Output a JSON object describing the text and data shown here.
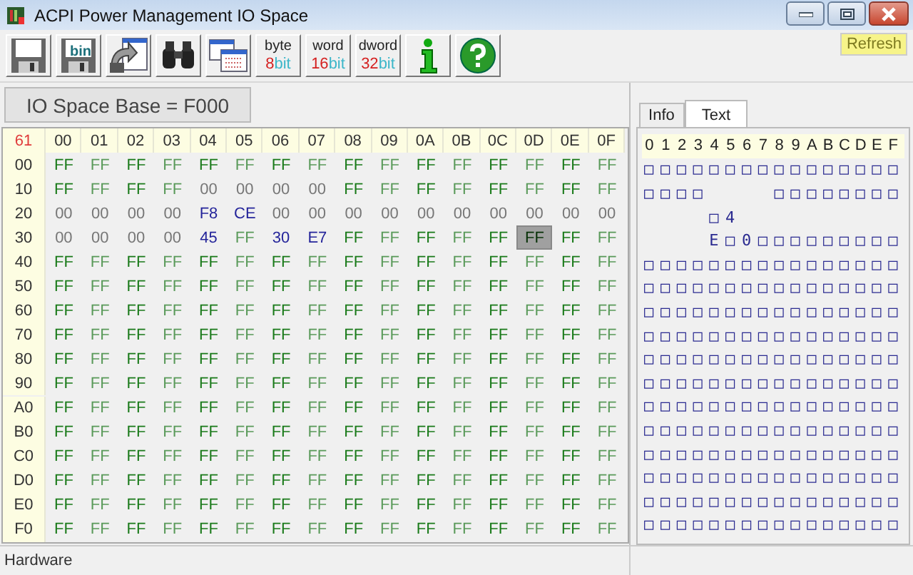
{
  "window": {
    "title": "ACPI Power Management IO Space"
  },
  "toolbar": [
    {
      "kind": "save"
    },
    {
      "kind": "savebin",
      "label": "bin"
    },
    {
      "kind": "export"
    },
    {
      "kind": "find"
    },
    {
      "kind": "windows"
    },
    {
      "kind": "width",
      "top": "byte",
      "num": "8",
      "unit": "bit",
      "selected": false
    },
    {
      "kind": "width",
      "top": "word",
      "num": "16",
      "unit": "bit",
      "selected": false
    },
    {
      "kind": "width",
      "top": "dword",
      "num": "32",
      "unit": "bit",
      "selected": false
    },
    {
      "kind": "info"
    },
    {
      "kind": "help"
    }
  ],
  "refresh_button": "Refresh",
  "base_label": "IO Space Base = F000",
  "grid": {
    "corner": "61",
    "columns": [
      "00",
      "01",
      "02",
      "03",
      "04",
      "05",
      "06",
      "07",
      "08",
      "09",
      "0A",
      "0B",
      "0C",
      "0D",
      "0E",
      "0F"
    ],
    "rows": [
      {
        "address": "00",
        "cells": [
          {
            "text": "FF",
            "kind": "set",
            "selected": false
          },
          {
            "text": "FF",
            "kind": "set",
            "selected": false
          },
          {
            "text": "FF",
            "kind": "set",
            "selected": false
          },
          {
            "text": "FF",
            "kind": "set",
            "selected": false
          },
          {
            "text": "FF",
            "kind": "set",
            "selected": false
          },
          {
            "text": "FF",
            "kind": "set",
            "selected": false
          },
          {
            "text": "FF",
            "kind": "set",
            "selected": false
          },
          {
            "text": "FF",
            "kind": "set",
            "selected": false
          },
          {
            "text": "FF",
            "kind": "set",
            "selected": false
          },
          {
            "text": "FF",
            "kind": "set",
            "selected": false
          },
          {
            "text": "FF",
            "kind": "set",
            "selected": false
          },
          {
            "text": "FF",
            "kind": "set",
            "selected": false
          },
          {
            "text": "FF",
            "kind": "set",
            "selected": false
          },
          {
            "text": "FF",
            "kind": "set",
            "selected": false
          },
          {
            "text": "FF",
            "kind": "set",
            "selected": false
          },
          {
            "text": "FF",
            "kind": "set",
            "selected": false
          }
        ]
      },
      {
        "address": "10",
        "cells": [
          {
            "text": "FF",
            "kind": "set",
            "selected": false
          },
          {
            "text": "FF",
            "kind": "set",
            "selected": false
          },
          {
            "text": "FF",
            "kind": "set",
            "selected": false
          },
          {
            "text": "FF",
            "kind": "set",
            "selected": false
          },
          {
            "text": "00",
            "kind": "zero",
            "selected": false
          },
          {
            "text": "00",
            "kind": "zero",
            "selected": false
          },
          {
            "text": "00",
            "kind": "zero",
            "selected": false
          },
          {
            "text": "00",
            "kind": "zero",
            "selected": false
          },
          {
            "text": "FF",
            "kind": "set",
            "selected": false
          },
          {
            "text": "FF",
            "kind": "set",
            "selected": false
          },
          {
            "text": "FF",
            "kind": "set",
            "selected": false
          },
          {
            "text": "FF",
            "kind": "set",
            "selected": false
          },
          {
            "text": "FF",
            "kind": "set",
            "selected": false
          },
          {
            "text": "FF",
            "kind": "set",
            "selected": false
          },
          {
            "text": "FF",
            "kind": "set",
            "selected": false
          },
          {
            "text": "FF",
            "kind": "set",
            "selected": false
          }
        ]
      },
      {
        "address": "20",
        "cells": [
          {
            "text": "00",
            "kind": "zero",
            "selected": false
          },
          {
            "text": "00",
            "kind": "zero",
            "selected": false
          },
          {
            "text": "00",
            "kind": "zero",
            "selected": false
          },
          {
            "text": "00",
            "kind": "zero",
            "selected": false
          },
          {
            "text": "F8",
            "kind": "data",
            "selected": false
          },
          {
            "text": "CE",
            "kind": "data",
            "selected": false
          },
          {
            "text": "00",
            "kind": "zero",
            "selected": false
          },
          {
            "text": "00",
            "kind": "zero",
            "selected": false
          },
          {
            "text": "00",
            "kind": "zero",
            "selected": false
          },
          {
            "text": "00",
            "kind": "zero",
            "selected": false
          },
          {
            "text": "00",
            "kind": "zero",
            "selected": false
          },
          {
            "text": "00",
            "kind": "zero",
            "selected": false
          },
          {
            "text": "00",
            "kind": "zero",
            "selected": false
          },
          {
            "text": "00",
            "kind": "zero",
            "selected": false
          },
          {
            "text": "00",
            "kind": "zero",
            "selected": false
          },
          {
            "text": "00",
            "kind": "zero",
            "selected": false
          }
        ]
      },
      {
        "address": "30",
        "cells": [
          {
            "text": "00",
            "kind": "zero",
            "selected": false
          },
          {
            "text": "00",
            "kind": "zero",
            "selected": false
          },
          {
            "text": "00",
            "kind": "zero",
            "selected": false
          },
          {
            "text": "00",
            "kind": "zero",
            "selected": false
          },
          {
            "text": "45",
            "kind": "data",
            "selected": false
          },
          {
            "text": "FF",
            "kind": "set",
            "selected": false
          },
          {
            "text": "30",
            "kind": "data",
            "selected": false
          },
          {
            "text": "E7",
            "kind": "data",
            "selected": false
          },
          {
            "text": "FF",
            "kind": "set",
            "selected": false
          },
          {
            "text": "FF",
            "kind": "set",
            "selected": false
          },
          {
            "text": "FF",
            "kind": "set",
            "selected": false
          },
          {
            "text": "FF",
            "kind": "set",
            "selected": false
          },
          {
            "text": "FF",
            "kind": "set",
            "selected": false
          },
          {
            "text": "FF",
            "kind": "set",
            "selected": true
          },
          {
            "text": "FF",
            "kind": "set",
            "selected": false
          },
          {
            "text": "FF",
            "kind": "set",
            "selected": false
          }
        ]
      },
      {
        "address": "40",
        "cells": [
          {
            "text": "FF",
            "kind": "set",
            "selected": false
          },
          {
            "text": "FF",
            "kind": "set",
            "selected": false
          },
          {
            "text": "FF",
            "kind": "set",
            "selected": false
          },
          {
            "text": "FF",
            "kind": "set",
            "selected": false
          },
          {
            "text": "FF",
            "kind": "set",
            "selected": false
          },
          {
            "text": "FF",
            "kind": "set",
            "selected": false
          },
          {
            "text": "FF",
            "kind": "set",
            "selected": false
          },
          {
            "text": "FF",
            "kind": "set",
            "selected": false
          },
          {
            "text": "FF",
            "kind": "set",
            "selected": false
          },
          {
            "text": "FF",
            "kind": "set",
            "selected": false
          },
          {
            "text": "FF",
            "kind": "set",
            "selected": false
          },
          {
            "text": "FF",
            "kind": "set",
            "selected": false
          },
          {
            "text": "FF",
            "kind": "set",
            "selected": false
          },
          {
            "text": "FF",
            "kind": "set",
            "selected": false
          },
          {
            "text": "FF",
            "kind": "set",
            "selected": false
          },
          {
            "text": "FF",
            "kind": "set",
            "selected": false
          }
        ]
      },
      {
        "address": "50",
        "cells": [
          {
            "text": "FF",
            "kind": "set",
            "selected": false
          },
          {
            "text": "FF",
            "kind": "set",
            "selected": false
          },
          {
            "text": "FF",
            "kind": "set",
            "selected": false
          },
          {
            "text": "FF",
            "kind": "set",
            "selected": false
          },
          {
            "text": "FF",
            "kind": "set",
            "selected": false
          },
          {
            "text": "FF",
            "kind": "set",
            "selected": false
          },
          {
            "text": "FF",
            "kind": "set",
            "selected": false
          },
          {
            "text": "FF",
            "kind": "set",
            "selected": false
          },
          {
            "text": "FF",
            "kind": "set",
            "selected": false
          },
          {
            "text": "FF",
            "kind": "set",
            "selected": false
          },
          {
            "text": "FF",
            "kind": "set",
            "selected": false
          },
          {
            "text": "FF",
            "kind": "set",
            "selected": false
          },
          {
            "text": "FF",
            "kind": "set",
            "selected": false
          },
          {
            "text": "FF",
            "kind": "set",
            "selected": false
          },
          {
            "text": "FF",
            "kind": "set",
            "selected": false
          },
          {
            "text": "FF",
            "kind": "set",
            "selected": false
          }
        ]
      },
      {
        "address": "60",
        "cells": [
          {
            "text": "FF",
            "kind": "set",
            "selected": false
          },
          {
            "text": "FF",
            "kind": "set",
            "selected": false
          },
          {
            "text": "FF",
            "kind": "set",
            "selected": false
          },
          {
            "text": "FF",
            "kind": "set",
            "selected": false
          },
          {
            "text": "FF",
            "kind": "set",
            "selected": false
          },
          {
            "text": "FF",
            "kind": "set",
            "selected": false
          },
          {
            "text": "FF",
            "kind": "set",
            "selected": false
          },
          {
            "text": "FF",
            "kind": "set",
            "selected": false
          },
          {
            "text": "FF",
            "kind": "set",
            "selected": false
          },
          {
            "text": "FF",
            "kind": "set",
            "selected": false
          },
          {
            "text": "FF",
            "kind": "set",
            "selected": false
          },
          {
            "text": "FF",
            "kind": "set",
            "selected": false
          },
          {
            "text": "FF",
            "kind": "set",
            "selected": false
          },
          {
            "text": "FF",
            "kind": "set",
            "selected": false
          },
          {
            "text": "FF",
            "kind": "set",
            "selected": false
          },
          {
            "text": "FF",
            "kind": "set",
            "selected": false
          }
        ]
      },
      {
        "address": "70",
        "cells": [
          {
            "text": "FF",
            "kind": "set",
            "selected": false
          },
          {
            "text": "FF",
            "kind": "set",
            "selected": false
          },
          {
            "text": "FF",
            "kind": "set",
            "selected": false
          },
          {
            "text": "FF",
            "kind": "set",
            "selected": false
          },
          {
            "text": "FF",
            "kind": "set",
            "selected": false
          },
          {
            "text": "FF",
            "kind": "set",
            "selected": false
          },
          {
            "text": "FF",
            "kind": "set",
            "selected": false
          },
          {
            "text": "FF",
            "kind": "set",
            "selected": false
          },
          {
            "text": "FF",
            "kind": "set",
            "selected": false
          },
          {
            "text": "FF",
            "kind": "set",
            "selected": false
          },
          {
            "text": "FF",
            "kind": "set",
            "selected": false
          },
          {
            "text": "FF",
            "kind": "set",
            "selected": false
          },
          {
            "text": "FF",
            "kind": "set",
            "selected": false
          },
          {
            "text": "FF",
            "kind": "set",
            "selected": false
          },
          {
            "text": "FF",
            "kind": "set",
            "selected": false
          },
          {
            "text": "FF",
            "kind": "set",
            "selected": false
          }
        ]
      },
      {
        "address": "80",
        "cells": [
          {
            "text": "FF",
            "kind": "set",
            "selected": false
          },
          {
            "text": "FF",
            "kind": "set",
            "selected": false
          },
          {
            "text": "FF",
            "kind": "set",
            "selected": false
          },
          {
            "text": "FF",
            "kind": "set",
            "selected": false
          },
          {
            "text": "FF",
            "kind": "set",
            "selected": false
          },
          {
            "text": "FF",
            "kind": "set",
            "selected": false
          },
          {
            "text": "FF",
            "kind": "set",
            "selected": false
          },
          {
            "text": "FF",
            "kind": "set",
            "selected": false
          },
          {
            "text": "FF",
            "kind": "set",
            "selected": false
          },
          {
            "text": "FF",
            "kind": "set",
            "selected": false
          },
          {
            "text": "FF",
            "kind": "set",
            "selected": false
          },
          {
            "text": "FF",
            "kind": "set",
            "selected": false
          },
          {
            "text": "FF",
            "kind": "set",
            "selected": false
          },
          {
            "text": "FF",
            "kind": "set",
            "selected": false
          },
          {
            "text": "FF",
            "kind": "set",
            "selected": false
          },
          {
            "text": "FF",
            "kind": "set",
            "selected": false
          }
        ]
      },
      {
        "address": "90",
        "cells": [
          {
            "text": "FF",
            "kind": "set",
            "selected": false
          },
          {
            "text": "FF",
            "kind": "set",
            "selected": false
          },
          {
            "text": "FF",
            "kind": "set",
            "selected": false
          },
          {
            "text": "FF",
            "kind": "set",
            "selected": false
          },
          {
            "text": "FF",
            "kind": "set",
            "selected": false
          },
          {
            "text": "FF",
            "kind": "set",
            "selected": false
          },
          {
            "text": "FF",
            "kind": "set",
            "selected": false
          },
          {
            "text": "FF",
            "kind": "set",
            "selected": false
          },
          {
            "text": "FF",
            "kind": "set",
            "selected": false
          },
          {
            "text": "FF",
            "kind": "set",
            "selected": false
          },
          {
            "text": "FF",
            "kind": "set",
            "selected": false
          },
          {
            "text": "FF",
            "kind": "set",
            "selected": false
          },
          {
            "text": "FF",
            "kind": "set",
            "selected": false
          },
          {
            "text": "FF",
            "kind": "set",
            "selected": false
          },
          {
            "text": "FF",
            "kind": "set",
            "selected": false
          },
          {
            "text": "FF",
            "kind": "set",
            "selected": false
          }
        ]
      },
      {
        "address": "A0",
        "cells": [
          {
            "text": "FF",
            "kind": "set",
            "selected": false
          },
          {
            "text": "FF",
            "kind": "set",
            "selected": false
          },
          {
            "text": "FF",
            "kind": "set",
            "selected": false
          },
          {
            "text": "FF",
            "kind": "set",
            "selected": false
          },
          {
            "text": "FF",
            "kind": "set",
            "selected": false
          },
          {
            "text": "FF",
            "kind": "set",
            "selected": false
          },
          {
            "text": "FF",
            "kind": "set",
            "selected": false
          },
          {
            "text": "FF",
            "kind": "set",
            "selected": false
          },
          {
            "text": "FF",
            "kind": "set",
            "selected": false
          },
          {
            "text": "FF",
            "kind": "set",
            "selected": false
          },
          {
            "text": "FF",
            "kind": "set",
            "selected": false
          },
          {
            "text": "FF",
            "kind": "set",
            "selected": false
          },
          {
            "text": "FF",
            "kind": "set",
            "selected": false
          },
          {
            "text": "FF",
            "kind": "set",
            "selected": false
          },
          {
            "text": "FF",
            "kind": "set",
            "selected": false
          },
          {
            "text": "FF",
            "kind": "set",
            "selected": false
          }
        ]
      },
      {
        "address": "B0",
        "cells": [
          {
            "text": "FF",
            "kind": "set",
            "selected": false
          },
          {
            "text": "FF",
            "kind": "set",
            "selected": false
          },
          {
            "text": "FF",
            "kind": "set",
            "selected": false
          },
          {
            "text": "FF",
            "kind": "set",
            "selected": false
          },
          {
            "text": "FF",
            "kind": "set",
            "selected": false
          },
          {
            "text": "FF",
            "kind": "set",
            "selected": false
          },
          {
            "text": "FF",
            "kind": "set",
            "selected": false
          },
          {
            "text": "FF",
            "kind": "set",
            "selected": false
          },
          {
            "text": "FF",
            "kind": "set",
            "selected": false
          },
          {
            "text": "FF",
            "kind": "set",
            "selected": false
          },
          {
            "text": "FF",
            "kind": "set",
            "selected": false
          },
          {
            "text": "FF",
            "kind": "set",
            "selected": false
          },
          {
            "text": "FF",
            "kind": "set",
            "selected": false
          },
          {
            "text": "FF",
            "kind": "set",
            "selected": false
          },
          {
            "text": "FF",
            "kind": "set",
            "selected": false
          },
          {
            "text": "FF",
            "kind": "set",
            "selected": false
          }
        ]
      },
      {
        "address": "C0",
        "cells": [
          {
            "text": "FF",
            "kind": "set",
            "selected": false
          },
          {
            "text": "FF",
            "kind": "set",
            "selected": false
          },
          {
            "text": "FF",
            "kind": "set",
            "selected": false
          },
          {
            "text": "FF",
            "kind": "set",
            "selected": false
          },
          {
            "text": "FF",
            "kind": "set",
            "selected": false
          },
          {
            "text": "FF",
            "kind": "set",
            "selected": false
          },
          {
            "text": "FF",
            "kind": "set",
            "selected": false
          },
          {
            "text": "FF",
            "kind": "set",
            "selected": false
          },
          {
            "text": "FF",
            "kind": "set",
            "selected": false
          },
          {
            "text": "FF",
            "kind": "set",
            "selected": false
          },
          {
            "text": "FF",
            "kind": "set",
            "selected": false
          },
          {
            "text": "FF",
            "kind": "set",
            "selected": false
          },
          {
            "text": "FF",
            "kind": "set",
            "selected": false
          },
          {
            "text": "FF",
            "kind": "set",
            "selected": false
          },
          {
            "text": "FF",
            "kind": "set",
            "selected": false
          },
          {
            "text": "FF",
            "kind": "set",
            "selected": false
          }
        ]
      },
      {
        "address": "D0",
        "cells": [
          {
            "text": "FF",
            "kind": "set",
            "selected": false
          },
          {
            "text": "FF",
            "kind": "set",
            "selected": false
          },
          {
            "text": "FF",
            "kind": "set",
            "selected": false
          },
          {
            "text": "FF",
            "kind": "set",
            "selected": false
          },
          {
            "text": "FF",
            "kind": "set",
            "selected": false
          },
          {
            "text": "FF",
            "kind": "set",
            "selected": false
          },
          {
            "text": "FF",
            "kind": "set",
            "selected": false
          },
          {
            "text": "FF",
            "kind": "set",
            "selected": false
          },
          {
            "text": "FF",
            "kind": "set",
            "selected": false
          },
          {
            "text": "FF",
            "kind": "set",
            "selected": false
          },
          {
            "text": "FF",
            "kind": "set",
            "selected": false
          },
          {
            "text": "FF",
            "kind": "set",
            "selected": false
          },
          {
            "text": "FF",
            "kind": "set",
            "selected": false
          },
          {
            "text": "FF",
            "kind": "set",
            "selected": false
          },
          {
            "text": "FF",
            "kind": "set",
            "selected": false
          },
          {
            "text": "FF",
            "kind": "set",
            "selected": false
          }
        ]
      },
      {
        "address": "E0",
        "cells": [
          {
            "text": "FF",
            "kind": "set",
            "selected": false
          },
          {
            "text": "FF",
            "kind": "set",
            "selected": false
          },
          {
            "text": "FF",
            "kind": "set",
            "selected": false
          },
          {
            "text": "FF",
            "kind": "set",
            "selected": false
          },
          {
            "text": "FF",
            "kind": "set",
            "selected": false
          },
          {
            "text": "FF",
            "kind": "set",
            "selected": false
          },
          {
            "text": "FF",
            "kind": "set",
            "selected": false
          },
          {
            "text": "FF",
            "kind": "set",
            "selected": false
          },
          {
            "text": "FF",
            "kind": "set",
            "selected": false
          },
          {
            "text": "FF",
            "kind": "set",
            "selected": false
          },
          {
            "text": "FF",
            "kind": "set",
            "selected": false
          },
          {
            "text": "FF",
            "kind": "set",
            "selected": false
          },
          {
            "text": "FF",
            "kind": "set",
            "selected": false
          },
          {
            "text": "FF",
            "kind": "set",
            "selected": false
          },
          {
            "text": "FF",
            "kind": "set",
            "selected": false
          },
          {
            "text": "FF",
            "kind": "set",
            "selected": false
          }
        ]
      },
      {
        "address": "F0",
        "cells": [
          {
            "text": "FF",
            "kind": "set",
            "selected": false
          },
          {
            "text": "FF",
            "kind": "set",
            "selected": false
          },
          {
            "text": "FF",
            "kind": "set",
            "selected": false
          },
          {
            "text": "FF",
            "kind": "set",
            "selected": false
          },
          {
            "text": "FF",
            "kind": "set",
            "selected": false
          },
          {
            "text": "FF",
            "kind": "set",
            "selected": false
          },
          {
            "text": "FF",
            "kind": "set",
            "selected": false
          },
          {
            "text": "FF",
            "kind": "set",
            "selected": false
          },
          {
            "text": "FF",
            "kind": "set",
            "selected": false
          },
          {
            "text": "FF",
            "kind": "set",
            "selected": false
          },
          {
            "text": "FF",
            "kind": "set",
            "selected": false
          },
          {
            "text": "FF",
            "kind": "set",
            "selected": false
          },
          {
            "text": "FF",
            "kind": "set",
            "selected": false
          },
          {
            "text": "FF",
            "kind": "set",
            "selected": false
          },
          {
            "text": "FF",
            "kind": "set",
            "selected": false
          },
          {
            "text": "FF",
            "kind": "set",
            "selected": false
          }
        ]
      }
    ]
  },
  "side_tabs": [
    {
      "label": "Info",
      "selected": false
    },
    {
      "label": "Text",
      "selected": true
    }
  ],
  "text_view": {
    "columns": [
      "0",
      "1",
      "2",
      "3",
      "4",
      "5",
      "6",
      "7",
      "8",
      "9",
      "A",
      "B",
      "C",
      "D",
      "E",
      "F"
    ],
    "rows": [
      "□□□□□□□□□□□□□□□□",
      "□□□□    □□□□□□□□",
      "    □4          ",
      "    E□0□□□□□□□□□",
      "□□□□□□□□□□□□□□□□",
      "□□□□□□□□□□□□□□□□",
      "□□□□□□□□□□□□□□□□",
      "□□□□□□□□□□□□□□□□",
      "□□□□□□□□□□□□□□□□",
      "□□□□□□□□□□□□□□□□",
      "□□□□□□□□□□□□□□□□",
      "□□□□□□□□□□□□□□□□",
      "□□□□□□□□□□□□□□□□",
      "□□□□□□□□□□□□□□□□",
      "□□□□□□□□□□□□□□□□",
      "□□□□□□□□□□□□□□□□"
    ]
  },
  "status_bar": "Hardware"
}
